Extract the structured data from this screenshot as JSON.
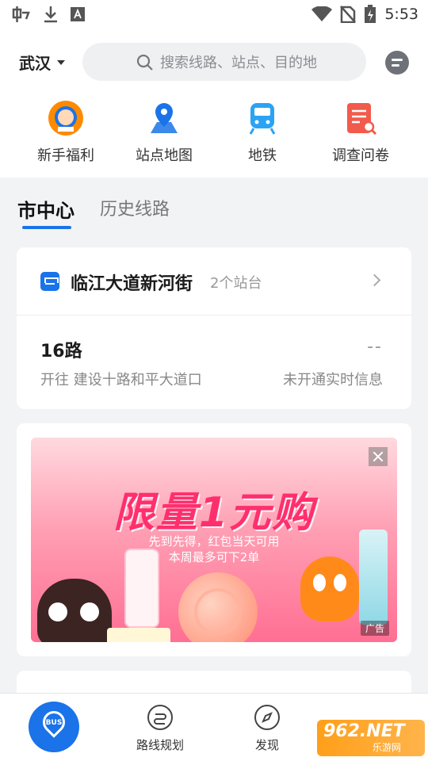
{
  "status_bar": {
    "time": "5:53",
    "left_icons": [
      "app-notification-icon",
      "download-icon",
      "font-app-icon"
    ],
    "right_icons": [
      "wifi-icon",
      "no-sim-icon",
      "battery-charging-icon"
    ]
  },
  "header": {
    "city": "武汉",
    "search_placeholder": "搜索线路、站点、目的地",
    "chat_icon": "chat-bubble-icon"
  },
  "quick_nav": [
    {
      "label": "新手福利",
      "icon": "newbie-welfare-icon",
      "color": "#ff8a00"
    },
    {
      "label": "站点地图",
      "icon": "map-pin-icon",
      "color": "#1a73e8"
    },
    {
      "label": "地铁",
      "icon": "metro-train-icon",
      "color": "#2aa3f5"
    },
    {
      "label": "调查问卷",
      "icon": "survey-icon",
      "color": "#f25a4b"
    }
  ],
  "tabs": [
    {
      "label": "市中心",
      "active": true
    },
    {
      "label": "历史线路",
      "active": false
    }
  ],
  "station": {
    "name": "临江大道新河街",
    "count": "2个站台"
  },
  "route": {
    "number": "16路",
    "direction": "开往 建设十路和平大道口",
    "eta": "--",
    "realtime_status": "未开通实时信息"
  },
  "ad": {
    "headline": "限量1元购",
    "sub1": "先到先得，红包当天可用",
    "sub2": "本周最多可下2单",
    "tag": "广告"
  },
  "bottom_nav": {
    "bus_label": "BUS",
    "items": [
      {
        "label": "路线规划",
        "icon": "route-planning-icon"
      },
      {
        "label": "发现",
        "icon": "compass-icon"
      }
    ]
  },
  "watermark": {
    "big": "962.NET",
    "small": "乐游网"
  },
  "colors": {
    "accent": "#1a73e8",
    "ad_pink": "#ff2f6e"
  }
}
